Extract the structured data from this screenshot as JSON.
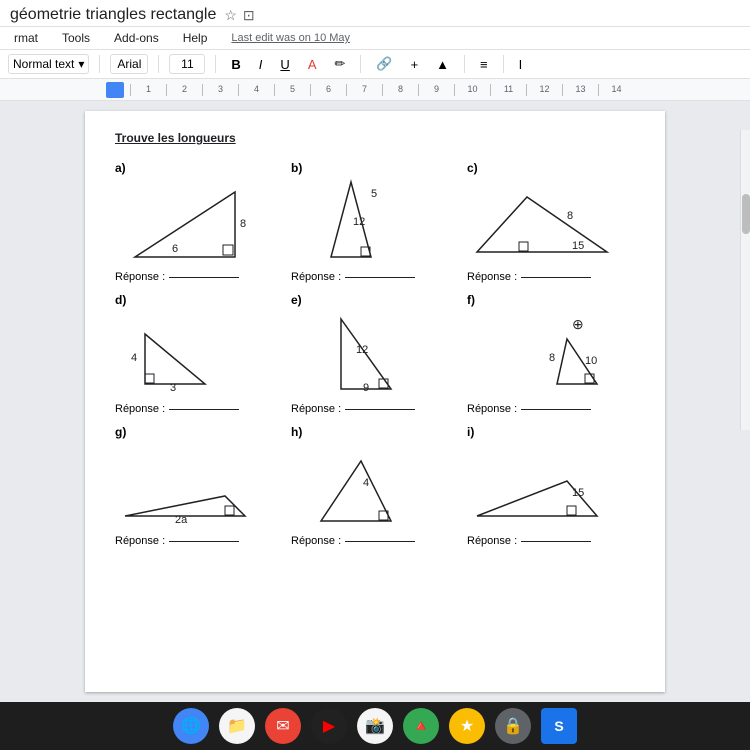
{
  "window": {
    "title": "géometrie triangles rectangle",
    "last_edit": "Last edit was on 10 May"
  },
  "menu": {
    "items": [
      "rmat",
      "Tools",
      "Add-ons",
      "Help"
    ]
  },
  "toolbar": {
    "style": "Normal text",
    "font": "Arial",
    "size": "11",
    "bold": "B",
    "italic": "I",
    "underline": "U"
  },
  "ruler": {
    "marks": [
      "1",
      "2",
      "3",
      "4",
      "5",
      "6",
      "7",
      "8",
      "9",
      "10",
      "11",
      "12",
      "13",
      "14"
    ]
  },
  "problems": [
    {
      "id": "a",
      "sides": {
        "top": "6",
        "right": "8",
        "hyp": ""
      },
      "reponse": "Réponse :"
    },
    {
      "id": "b",
      "sides": {
        "top": "5",
        "right": "12",
        "hyp": ""
      },
      "reponse": "Réponse :"
    },
    {
      "id": "c",
      "sides": {
        "top": "",
        "right": "8",
        "hyp": "15"
      },
      "reponse": "Réponse :"
    },
    {
      "id": "d",
      "sides": {
        "top": "4",
        "right": "",
        "bottom": "3"
      },
      "reponse": "Réponse :"
    },
    {
      "id": "e",
      "sides": {
        "top": "12",
        "right": "",
        "bottom": "9"
      },
      "reponse": "Réponse :"
    },
    {
      "id": "f",
      "sides": {
        "top": "8",
        "right": "10",
        "hyp": ""
      },
      "reponse": "Réponse :"
    },
    {
      "id": "g",
      "sides": {
        "long": "2a",
        "bottom": ""
      },
      "reponse": "Réponse :"
    },
    {
      "id": "h",
      "sides": {
        "top": "4",
        "bottom": ""
      },
      "reponse": "Réponse :"
    },
    {
      "id": "i",
      "sides": {
        "top": "15",
        "bottom": ""
      },
      "reponse": "Réponse :"
    }
  ],
  "taskbar": {
    "icons": [
      "🌐",
      "📁",
      "✉",
      "▶",
      "📸",
      "🔺",
      "★",
      "🔒",
      "S"
    ]
  }
}
